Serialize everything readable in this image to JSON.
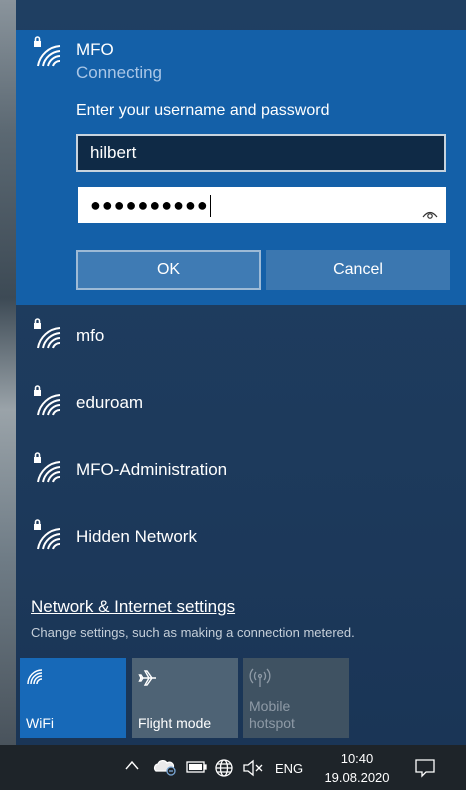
{
  "active_network": {
    "name": "MFO",
    "status": "Connecting",
    "prompt": "Enter your username and password",
    "username_value": "hilbert",
    "password_mask": "●●●●●●●●●●",
    "ok_label": "OK",
    "cancel_label": "Cancel"
  },
  "networks": [
    {
      "name": "mfo"
    },
    {
      "name": "eduroam"
    },
    {
      "name": "MFO-Administration"
    },
    {
      "name": "Hidden Network"
    }
  ],
  "settings": {
    "link_label": "Network & Internet settings",
    "description": "Change settings, such as making a connection metered."
  },
  "quick_actions": {
    "wifi_label": "WiFi",
    "flight_label": "Flight mode",
    "hotspot_label_1": "Mobile",
    "hotspot_label_2": "hotspot"
  },
  "taskbar": {
    "language": "ENG",
    "time": "10:40",
    "date": "19.08.2020"
  },
  "colors": {
    "accent": "#1460a8",
    "flyout_bg": "#1f3f62",
    "taskbar_bg": "#1e2429"
  },
  "icons": [
    "wifi-secured-icon",
    "show-password-icon",
    "flight-mode-icon",
    "hotspot-icon",
    "chevron-up-icon",
    "onedrive-icon",
    "battery-icon",
    "network-icon",
    "volume-muted-icon",
    "action-center-icon"
  ]
}
